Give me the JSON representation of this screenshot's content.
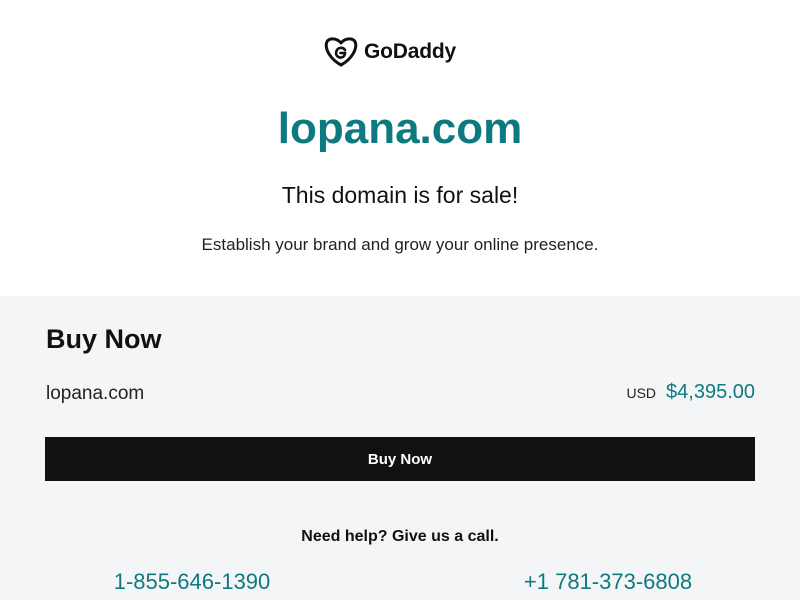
{
  "header": {
    "brand_name": "GoDaddy",
    "logo_icon": "godaddy-logo-icon"
  },
  "hero": {
    "domain": "lopana.com",
    "headline": "This domain is for sale!",
    "tagline": "Establish your brand and grow your online presence."
  },
  "purchase": {
    "heading": "Buy Now",
    "domain": "lopana.com",
    "currency": "USD",
    "price": "$4,395.00",
    "button_label": "Buy Now"
  },
  "support": {
    "help_text": "Need help? Give us a call.",
    "phone_numbers": [
      "1-855-646-1390",
      "+1 781-373-6808"
    ]
  },
  "colors": {
    "accent": "#0e7a80",
    "button_bg": "#111111",
    "section_bg": "#f4f5f7"
  }
}
